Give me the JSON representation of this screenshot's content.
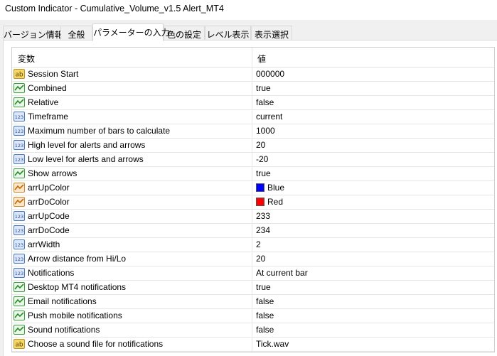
{
  "window": {
    "title": "Custom Indicator - Cumulative_Volume_v1.5  Alert_MT4"
  },
  "tabs": [
    {
      "label": "バージョン情報"
    },
    {
      "label": "全般"
    },
    {
      "label": "パラメーターの入力"
    },
    {
      "label": "色の設定"
    },
    {
      "label": "レベル表示"
    },
    {
      "label": "表示選択"
    }
  ],
  "grid": {
    "header_variable": "変数",
    "header_value": "値",
    "rows": [
      {
        "icon": "ab-string-icon",
        "name": "Session Start",
        "value": "000000"
      },
      {
        "icon": "bool-icon",
        "name": "Combined",
        "value": "true"
      },
      {
        "icon": "bool-icon",
        "name": "Relative",
        "value": "false"
      },
      {
        "icon": "int-123-icon",
        "name": "Timeframe",
        "value": "current"
      },
      {
        "icon": "int-123-icon",
        "name": "Maximum number of bars to calculate",
        "value": "1000"
      },
      {
        "icon": "int-123-icon",
        "name": "High level for alerts and arrows",
        "value": "20"
      },
      {
        "icon": "int-123-icon",
        "name": "Low level for alerts and arrows",
        "value": "-20"
      },
      {
        "icon": "bool-icon",
        "name": "Show arrows",
        "value": "true"
      },
      {
        "icon": "color-icon",
        "name": "arrUpColor",
        "value": "Blue",
        "swatch": "#0000ff"
      },
      {
        "icon": "color-icon",
        "name": "arrDoColor",
        "value": "Red",
        "swatch": "#ff0000"
      },
      {
        "icon": "int-123-icon",
        "name": "arrUpCode",
        "value": "233"
      },
      {
        "icon": "int-123-icon",
        "name": "arrDoCode",
        "value": "234"
      },
      {
        "icon": "int-123-icon",
        "name": "arrWidth",
        "value": "2"
      },
      {
        "icon": "int-123-icon",
        "name": "Arrow distance from Hi/Lo",
        "value": "20"
      },
      {
        "icon": "int-123-icon",
        "name": "Notifications",
        "value": "At current bar"
      },
      {
        "icon": "bool-icon",
        "name": "Desktop MT4 notifications",
        "value": "true"
      },
      {
        "icon": "bool-icon",
        "name": "Email notifications",
        "value": "false"
      },
      {
        "icon": "bool-icon",
        "name": "Push mobile notifications",
        "value": "false"
      },
      {
        "icon": "bool-icon",
        "name": "Sound notifications",
        "value": "false"
      },
      {
        "icon": "ab-string-icon",
        "name": "Choose a sound file for notifications",
        "value": "Tick.wav"
      }
    ]
  }
}
